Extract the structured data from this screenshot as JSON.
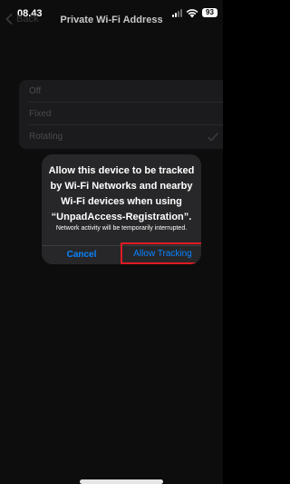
{
  "status_bar": {
    "time": "08.43",
    "battery": "93",
    "signal_icon": "cellular-signal-icon",
    "wifi_icon": "wifi-icon"
  },
  "nav": {
    "back_label": "Back",
    "title": "Private Wi-Fi Address"
  },
  "options": [
    {
      "label": "Off",
      "selected": false
    },
    {
      "label": "Fixed",
      "selected": false
    },
    {
      "label": "Rotating",
      "selected": true
    }
  ],
  "alert": {
    "title": "Allow this device to be tracked by Wi-Fi Networks and nearby Wi-Fi devices when using “UnpadAccess-Registration”.",
    "message": "Network activity will be temporarily interrupted.",
    "cancel_label": "Cancel",
    "allow_label": "Allow Tracking"
  },
  "colors": {
    "accent": "#0a84ff",
    "highlight": "#e01b24",
    "background": "#0d0d0d"
  }
}
